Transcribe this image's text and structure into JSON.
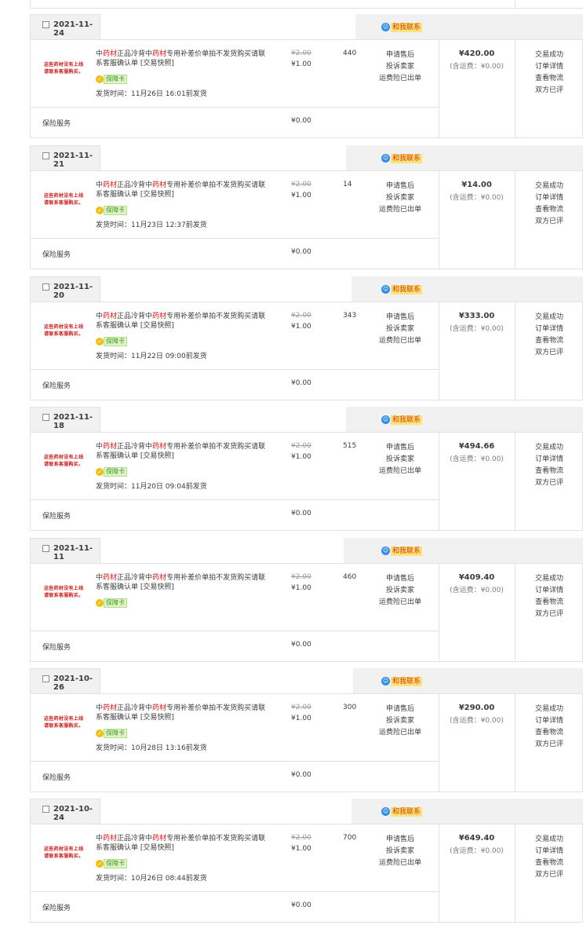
{
  "common": {
    "thumb_line1": "这些药材没有上线",
    "thumb_line2": "请联系客服购买。",
    "title_p1": "中",
    "title_hl": "药材",
    "title_p2": "正品冷背中",
    "title_p3": "专用补差价单拍不发货购买请联系客服确认单 [交易快照]",
    "badge_label": "保障卡",
    "contact_label": "和我联系",
    "original_price": "¥2.00",
    "unit_price": "¥1.00",
    "aftersale": [
      "申请售后",
      "投诉卖家",
      "运费险已出单"
    ],
    "status": [
      "交易成功",
      "订单详情",
      "查看物流",
      "双方已评"
    ],
    "insurance_label": "保险服务",
    "insurance_amount": "¥0.00"
  },
  "orders": [
    {
      "date": "2021-11-24",
      "qty": "440",
      "total": "¥420.00",
      "shipping_fee": "(含运费：¥0.00)",
      "ship_time": "发货时间：11月26日 16:01前发货"
    },
    {
      "date": "2021-11-21",
      "qty": "14",
      "total": "¥14.00",
      "shipping_fee": "(含运费：¥0.00)",
      "ship_time": "发货时间：11月23日 12:37前发货"
    },
    {
      "date": "2021-11-20",
      "qty": "343",
      "total": "¥333.00",
      "shipping_fee": "(含运费：¥0.00)",
      "ship_time": "发货时间：11月22日 09:00前发货"
    },
    {
      "date": "2021-11-18",
      "qty": "515",
      "total": "¥494.66",
      "shipping_fee": "(含运费：¥0.00)",
      "ship_time": "发货时间：11月20日 09:04前发货"
    },
    {
      "date": "2021-11-11",
      "qty": "460",
      "total": "¥409.40",
      "shipping_fee": "(含运费：¥0.00)",
      "ship_time": ""
    },
    {
      "date": "2021-10-26",
      "qty": "300",
      "total": "¥290.00",
      "shipping_fee": "(含运费：¥0.00)",
      "ship_time": "发货时间：10月28日 13:16前发货"
    },
    {
      "date": "2021-10-24",
      "qty": "700",
      "total": "¥649.40",
      "shipping_fee": "(含运费：¥0.00)",
      "ship_time": "发货时间：10月26日 08:44前发货"
    }
  ]
}
